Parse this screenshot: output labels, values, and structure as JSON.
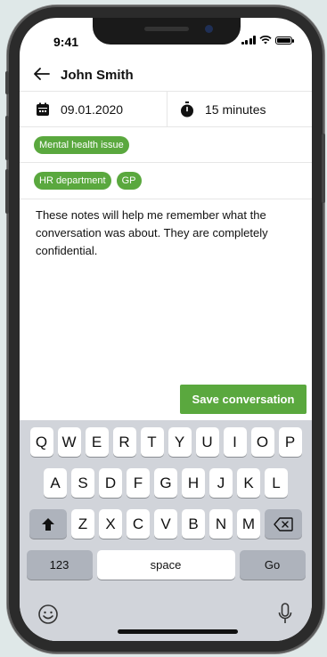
{
  "status_bar": {
    "time": "9:41"
  },
  "header": {
    "title": "John Smith"
  },
  "meta": {
    "date": "09.01.2020",
    "duration": "15 minutes"
  },
  "tags_row1": [
    "Mental health issue"
  ],
  "tags_row2": [
    "HR department",
    "GP"
  ],
  "notes": {
    "text": "These notes will help me remember what the conversation was about. They are completely confidential."
  },
  "actions": {
    "save_label": "Save conversation"
  },
  "keyboard": {
    "row1": [
      "Q",
      "W",
      "E",
      "R",
      "T",
      "Y",
      "U",
      "I",
      "O",
      "P"
    ],
    "row2": [
      "A",
      "S",
      "D",
      "F",
      "G",
      "H",
      "J",
      "K",
      "L"
    ],
    "row3": [
      "Z",
      "X",
      "C",
      "V",
      "B",
      "N",
      "M"
    ],
    "numbers_label": "123",
    "space_label": "space",
    "go_label": "Go"
  },
  "colors": {
    "accent": "#5aa83e",
    "keyboard_bg": "#d1d4da"
  },
  "icons": [
    "back-arrow-icon",
    "calendar-icon",
    "stopwatch-icon",
    "signal-icon",
    "wifi-icon",
    "battery-icon",
    "shift-icon",
    "backspace-icon",
    "emoji-icon",
    "microphone-icon"
  ]
}
